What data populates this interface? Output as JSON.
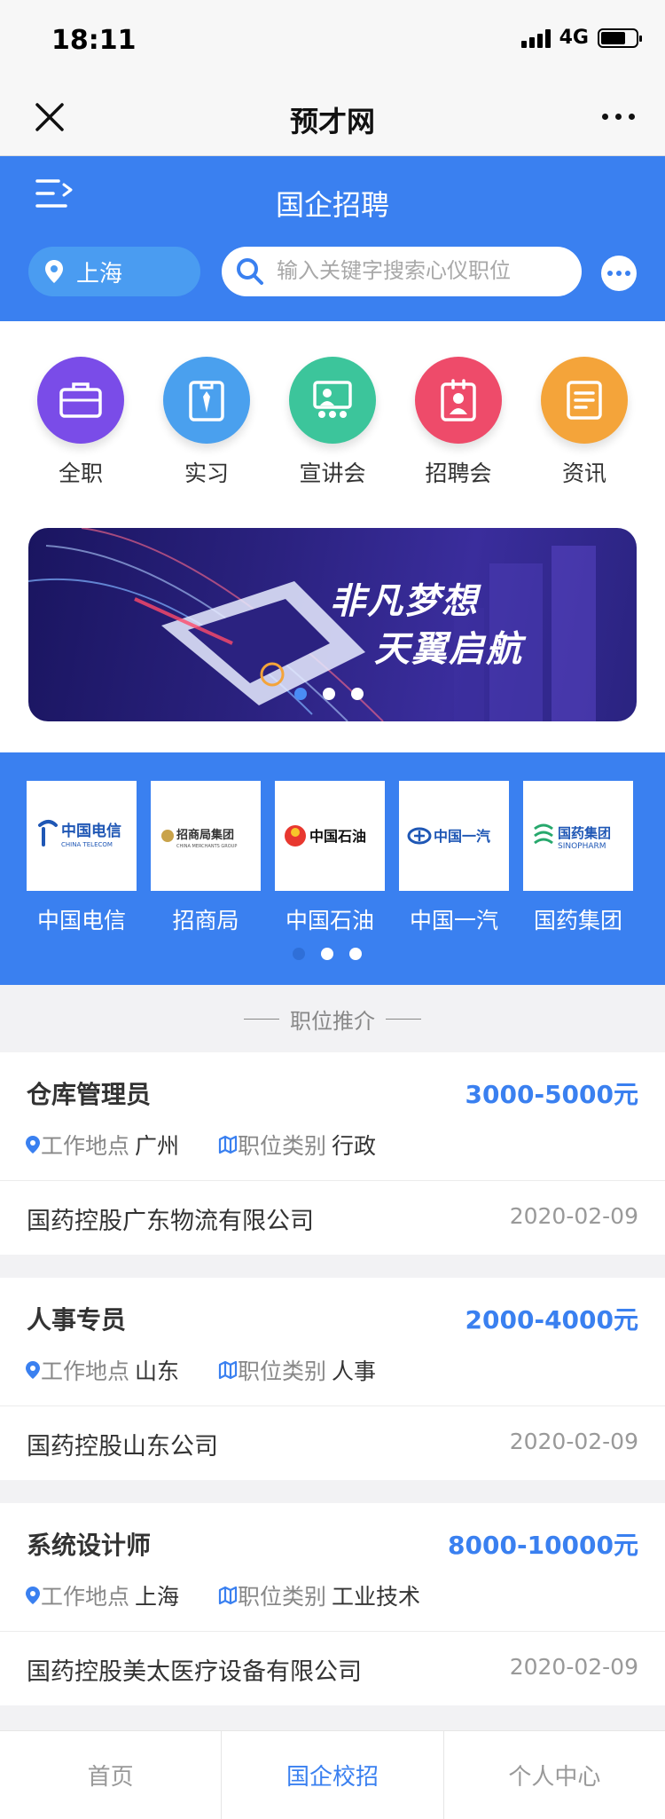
{
  "status_bar": {
    "time": "18:11",
    "network": "4G",
    "battery_level": 0.7
  },
  "title_bar": {
    "title": "预才网"
  },
  "header": {
    "title": "国企招聘",
    "city": "上海",
    "search_placeholder": "输入关键字搜索心仪职位"
  },
  "categories": [
    {
      "label": "全职",
      "icon": "briefcase-icon",
      "color": "#7a4ce8"
    },
    {
      "label": "实习",
      "icon": "badge-tie-icon",
      "color": "#4aa0ee"
    },
    {
      "label": "宣讲会",
      "icon": "presentation-icon",
      "color": "#3cc59b"
    },
    {
      "label": "招聘会",
      "icon": "id-card-icon",
      "color": "#ee4b6a"
    },
    {
      "label": "资讯",
      "icon": "news-icon",
      "color": "#f4a43a"
    }
  ],
  "banner": {
    "line1": "非凡梦想",
    "line2": "天翼启航",
    "slides": 3,
    "active_slide": 0
  },
  "companies": [
    {
      "name": "中国电信",
      "logo_text": "中国电信",
      "logo_sub": "CHINA TELECOM",
      "logo_color": "#1f57b5"
    },
    {
      "name": "招商局",
      "logo_text": "招商局集团",
      "logo_sub": "CHINA MERCHANTS GROUP",
      "logo_color": "#333333"
    },
    {
      "name": "中国石油",
      "logo_text": "中国石油",
      "logo_sub": "",
      "logo_color": "#111111"
    },
    {
      "name": "中国一汽",
      "logo_text": "中国一汽",
      "logo_sub": "",
      "logo_color": "#1f57b5"
    },
    {
      "name": "国药集团",
      "logo_text": "国药集团",
      "logo_sub": "SINOPHARM",
      "logo_color": "#1f57b5"
    }
  ],
  "companies_pager": {
    "slides": 3,
    "active_slide": 0
  },
  "section_title": "职位推介",
  "location_label": "工作地点",
  "category_label": "职位类别",
  "jobs": [
    {
      "title": "仓库管理员",
      "salary": "3000-5000元",
      "location": "广州",
      "category": "行政",
      "company": "国药控股广东物流有限公司",
      "date": "2020-02-09"
    },
    {
      "title": "人事专员",
      "salary": "2000-4000元",
      "location": "山东",
      "category": "人事",
      "company": "国药控股山东公司",
      "date": "2020-02-09"
    },
    {
      "title": "系统设计师",
      "salary": "8000-10000元",
      "location": "上海",
      "category": "工业技术",
      "company": "国药控股美太医疗设备有限公司",
      "date": "2020-02-09"
    }
  ],
  "tabs": [
    {
      "label": "首页",
      "active": false
    },
    {
      "label": "国企校招",
      "active": true
    },
    {
      "label": "个人中心",
      "active": false
    }
  ]
}
